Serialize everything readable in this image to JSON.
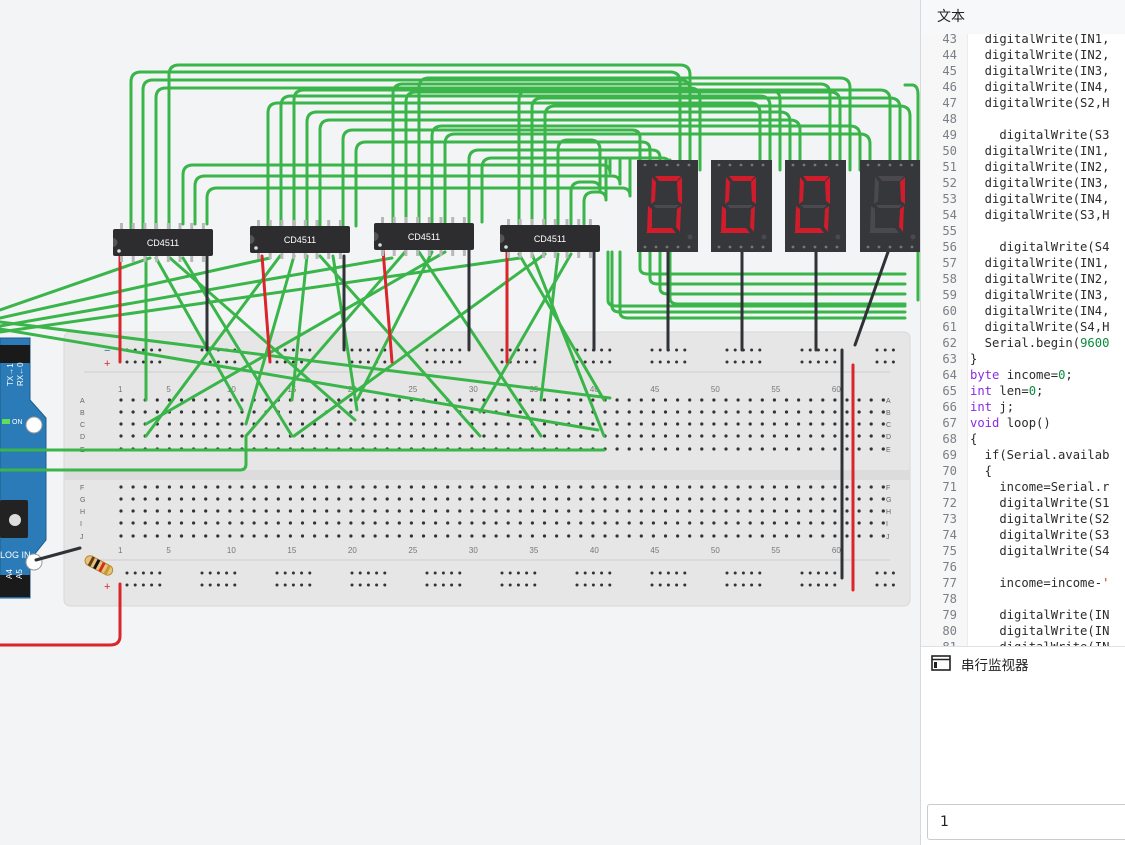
{
  "panel": {
    "title": "文本",
    "serial_title": "串行监视器",
    "serial_input_value": "1"
  },
  "chips": {
    "label": "CD4511"
  },
  "breadboard": {
    "row_letters": [
      "A",
      "B",
      "C",
      "D",
      "E",
      "F",
      "G",
      "H",
      "I",
      "J"
    ],
    "column_numbers": [
      "1",
      "5",
      "10",
      "15",
      "20",
      "25",
      "30",
      "35",
      "40",
      "45",
      "50",
      "55",
      "60"
    ],
    "plus": "+",
    "minus": "−"
  },
  "arduino": {
    "tx_label": "TX→1",
    "rx_label": "RX←0",
    "on_label": "ON",
    "analog_label": "LOG IN",
    "a4_label": "A4",
    "a5_label": "A5"
  },
  "displays": {
    "digits": [
      "0",
      "0",
      "0",
      "1"
    ],
    "segment_on_color": "#d01c2b",
    "segment_off_color": "#4a4a4e"
  },
  "colors": {
    "wire_green": "#3ab54a",
    "wire_red": "#d9252b",
    "wire_black": "#2f3236",
    "breadboard": "#e6e6e6",
    "arduino_blue": "#2a7bb8"
  },
  "code": [
    {
      "n": "43",
      "t": "  digitalWrite(IN1,"
    },
    {
      "n": "44",
      "t": "  digitalWrite(IN2,"
    },
    {
      "n": "45",
      "t": "  digitalWrite(IN3,"
    },
    {
      "n": "46",
      "t": "  digitalWrite(IN4,"
    },
    {
      "n": "47",
      "t": "  digitalWrite(S2,H"
    },
    {
      "n": "48",
      "t": ""
    },
    {
      "n": "49",
      "t": "    digitalWrite(S3"
    },
    {
      "n": "50",
      "t": "  digitalWrite(IN1,"
    },
    {
      "n": "51",
      "t": "  digitalWrite(IN2,"
    },
    {
      "n": "52",
      "t": "  digitalWrite(IN3,"
    },
    {
      "n": "53",
      "t": "  digitalWrite(IN4,"
    },
    {
      "n": "54",
      "t": "  digitalWrite(S3,H"
    },
    {
      "n": "55",
      "t": ""
    },
    {
      "n": "56",
      "t": "    digitalWrite(S4"
    },
    {
      "n": "57",
      "t": "  digitalWrite(IN1,"
    },
    {
      "n": "58",
      "t": "  digitalWrite(IN2,"
    },
    {
      "n": "59",
      "t": "  digitalWrite(IN3,"
    },
    {
      "n": "60",
      "t": "  digitalWrite(IN4,"
    },
    {
      "n": "61",
      "t": "  digitalWrite(S4,H"
    },
    {
      "n": "62",
      "t": "  Serial.begin(9600"
    },
    {
      "n": "63",
      "t": "}"
    },
    {
      "n": "64",
      "t": "byte income=0;"
    },
    {
      "n": "65",
      "t": "int len=0;"
    },
    {
      "n": "66",
      "t": "int j;"
    },
    {
      "n": "67",
      "t": "void loop()"
    },
    {
      "n": "68",
      "t": "{"
    },
    {
      "n": "69",
      "t": "  if(Serial.availab"
    },
    {
      "n": "70",
      "t": "  {"
    },
    {
      "n": "71",
      "t": "    income=Serial.r"
    },
    {
      "n": "72",
      "t": "    digitalWrite(S1"
    },
    {
      "n": "73",
      "t": "    digitalWrite(S2"
    },
    {
      "n": "74",
      "t": "    digitalWrite(S3"
    },
    {
      "n": "75",
      "t": "    digitalWrite(S4"
    },
    {
      "n": "76",
      "t": ""
    },
    {
      "n": "77",
      "t": "    income=income-'"
    },
    {
      "n": "78",
      "t": ""
    },
    {
      "n": "79",
      "t": "    digitalWrite(IN"
    },
    {
      "n": "80",
      "t": "    digitalWrite(IN"
    },
    {
      "n": "81",
      "t": "    digitalWrite(IN"
    }
  ]
}
